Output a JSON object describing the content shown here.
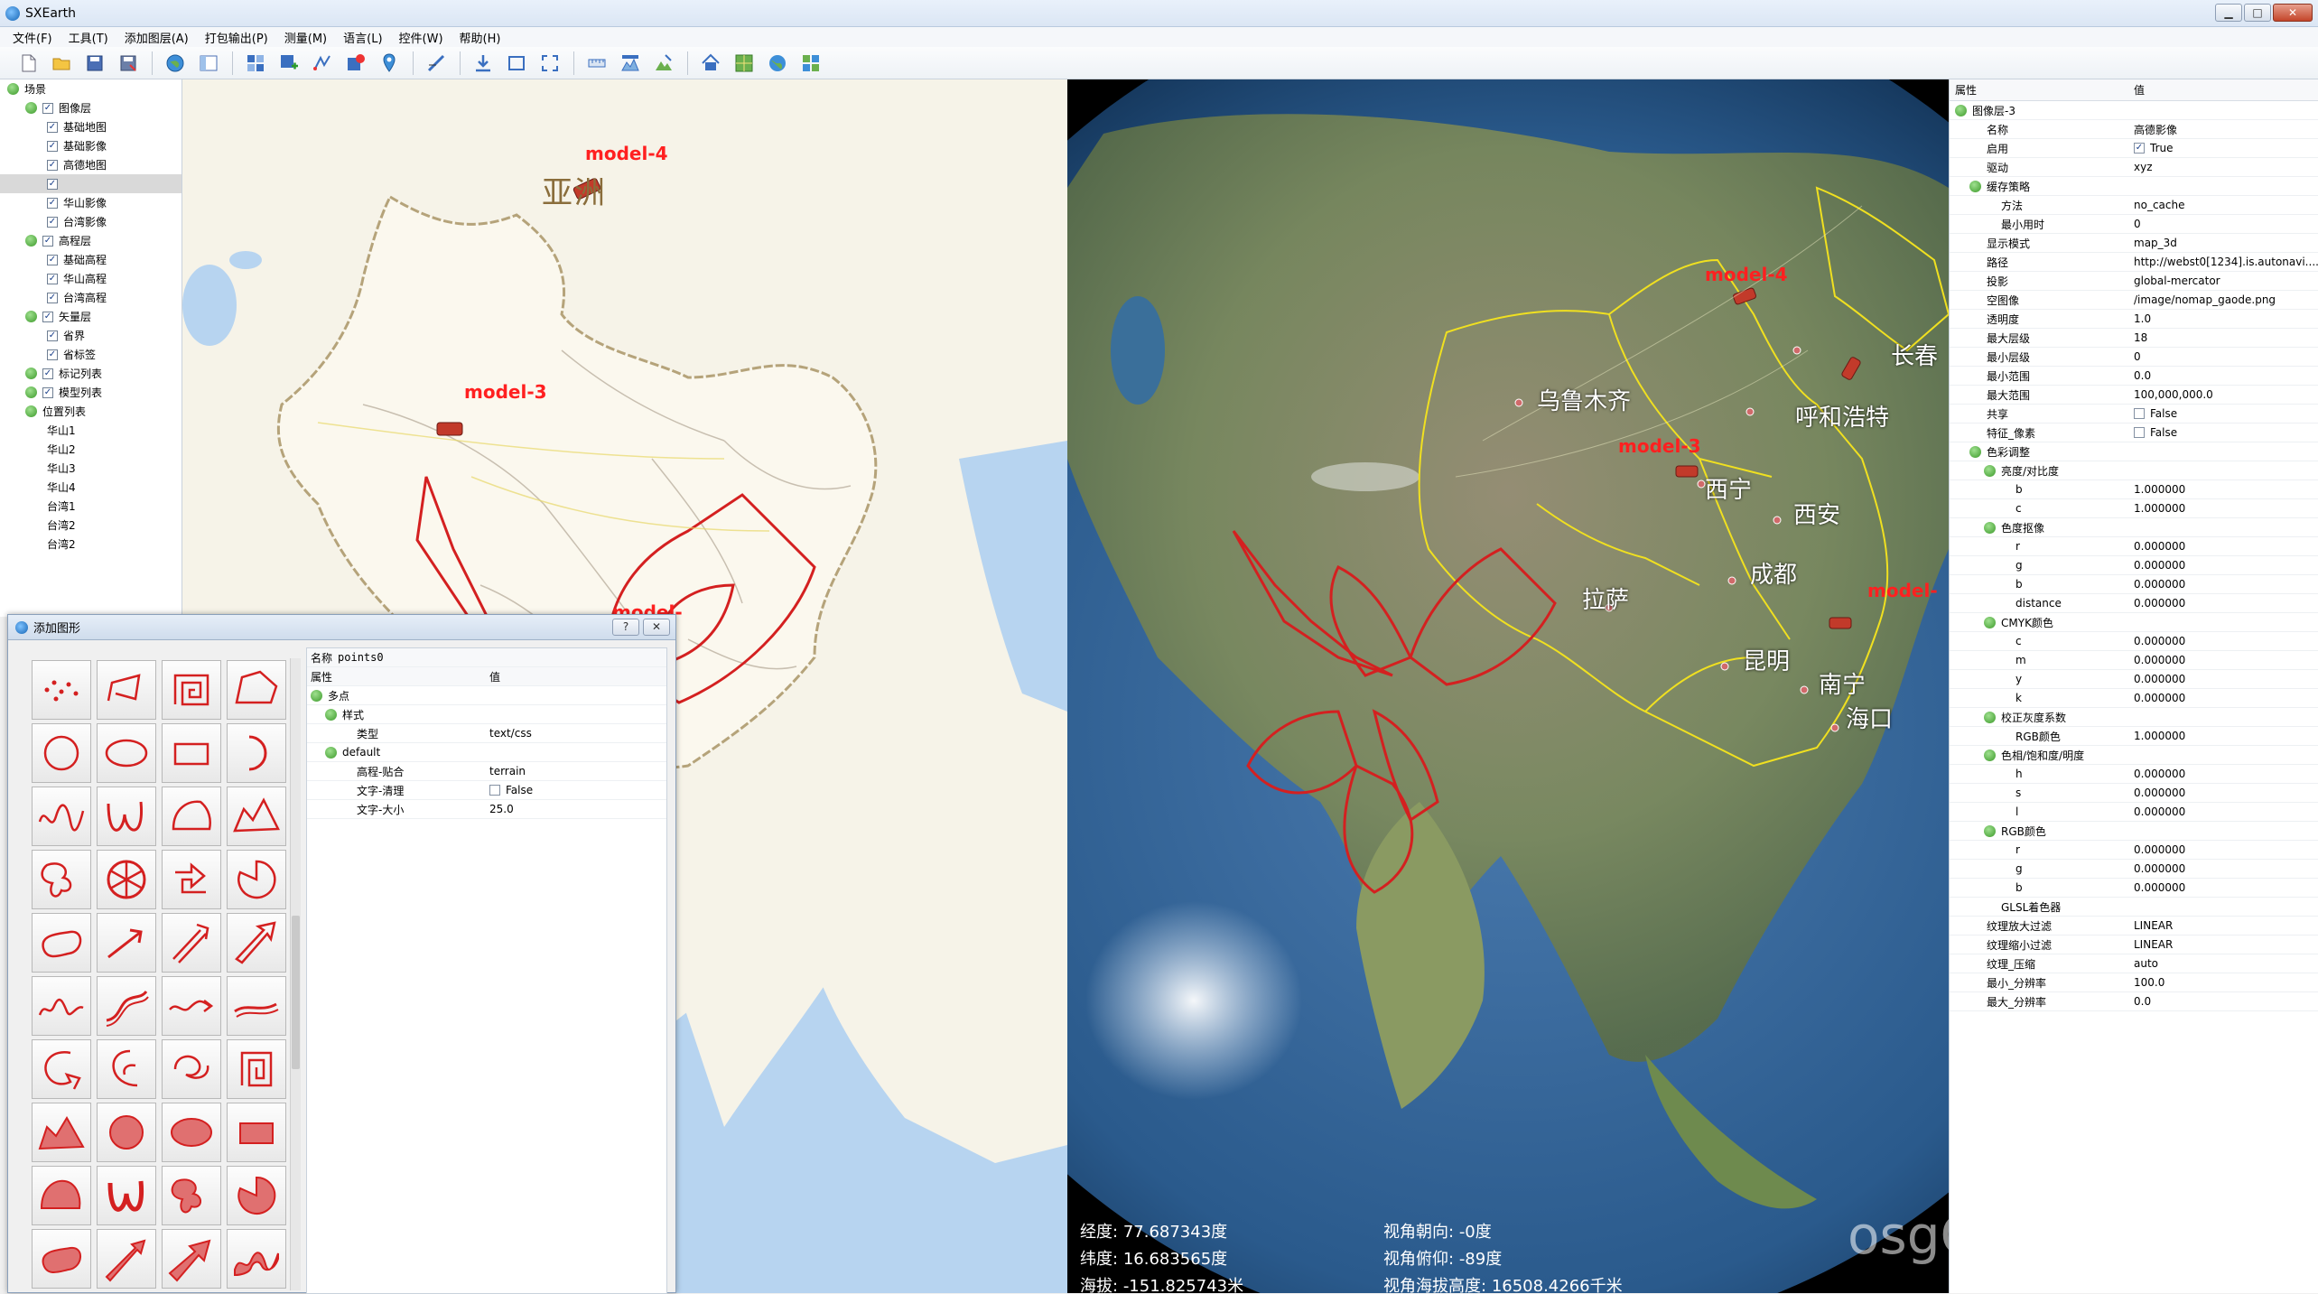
{
  "window": {
    "title": "SXEarth",
    "btn_min": "▁",
    "btn_max": "□",
    "btn_close": "✕"
  },
  "menu": [
    "文件(F)",
    "工具(T)",
    "添加图层(A)",
    "打包输出(P)",
    "测量(M)",
    "语言(L)",
    "控件(W)",
    "帮助(H)"
  ],
  "toolbar": [
    "new-file-icon",
    "open-folder-icon",
    "save-icon",
    "save-as-icon",
    "globe-icon",
    "layout-icon",
    "grid-tiles-icon",
    "add-layer-icon",
    "vector-icon",
    "pin-layer-icon",
    "placemark-icon",
    "measure-icon",
    "download-icon",
    "select-rect-icon",
    "fullscreen-icon",
    "ruler-icon",
    "profile-icon",
    "terrain-edit-icon",
    "home-icon",
    "map-icon",
    "earth-icon",
    "tile-icon"
  ],
  "scene_tree": {
    "rows": [
      {
        "level": 0,
        "exp": true,
        "chk": false,
        "label": "场景"
      },
      {
        "level": 1,
        "exp": true,
        "chk": true,
        "label": "图像层"
      },
      {
        "level": 2,
        "exp": false,
        "chk": true,
        "label": "基础地图"
      },
      {
        "level": 2,
        "exp": false,
        "chk": true,
        "label": "基础影像"
      },
      {
        "level": 2,
        "exp": false,
        "chk": true,
        "label": "高德地图"
      },
      {
        "level": 2,
        "exp": false,
        "chk": true,
        "label": "",
        "selected": true
      },
      {
        "level": 2,
        "exp": false,
        "chk": true,
        "label": "华山影像"
      },
      {
        "level": 2,
        "exp": false,
        "chk": true,
        "label": "台湾影像"
      },
      {
        "level": 1,
        "exp": true,
        "chk": true,
        "label": "高程层"
      },
      {
        "level": 2,
        "exp": false,
        "chk": true,
        "label": "基础高程"
      },
      {
        "level": 2,
        "exp": false,
        "chk": true,
        "label": "华山高程"
      },
      {
        "level": 2,
        "exp": false,
        "chk": true,
        "label": "台湾高程"
      },
      {
        "level": 1,
        "exp": true,
        "chk": true,
        "label": "矢量层"
      },
      {
        "level": 2,
        "exp": false,
        "chk": true,
        "label": "省界"
      },
      {
        "level": 2,
        "exp": false,
        "chk": true,
        "label": "省标签"
      },
      {
        "level": 1,
        "exp": true,
        "chk": true,
        "label": "标记列表"
      },
      {
        "level": 1,
        "exp": true,
        "chk": true,
        "label": "模型列表"
      },
      {
        "level": 1,
        "exp": true,
        "chk": false,
        "label": "位置列表"
      },
      {
        "level": 2,
        "exp": false,
        "chk": false,
        "label": "华山1"
      },
      {
        "level": 2,
        "exp": false,
        "chk": false,
        "label": "华山2"
      },
      {
        "level": 2,
        "exp": false,
        "chk": false,
        "label": "华山3"
      },
      {
        "level": 2,
        "exp": false,
        "chk": false,
        "label": "华山4"
      },
      {
        "level": 2,
        "exp": false,
        "chk": false,
        "label": "台湾1"
      },
      {
        "level": 2,
        "exp": false,
        "chk": false,
        "label": "台湾2"
      },
      {
        "level": 2,
        "exp": false,
        "chk": false,
        "label": "台湾2"
      }
    ]
  },
  "map2d": {
    "continent_label": "亚洲",
    "model_labels": [
      "model-4",
      "model-3",
      "model-"
    ]
  },
  "globe": {
    "cities": [
      "乌鲁木齐",
      "长春",
      "呼和浩特",
      "西宁",
      "西安",
      "成都",
      "拉萨",
      "昆明",
      "南宁",
      "海口"
    ],
    "model_labels": [
      "model-4",
      "model-3",
      "model-"
    ],
    "readout": {
      "lon_label": "经度:",
      "lon_value": "77.687343度",
      "lat_label": "纬度:",
      "lat_value": "16.683565度",
      "alt_label": "海拔:",
      "alt_value": "-151.825743米",
      "heading_label": "视角朝向:",
      "heading_value": "-0度",
      "pitch_label": "视角俯仰:",
      "pitch_value": "-89度",
      "eye_label": "视角海拔高度:",
      "eye_value": "16508.4266千米"
    },
    "watermark": "osgChina.org"
  },
  "props": {
    "header": [
      "属性",
      "值"
    ],
    "rows": [
      {
        "level": 0,
        "exp": true,
        "name": "图像层-3",
        "value": ""
      },
      {
        "level": 1,
        "name": "名称",
        "value": "高德影像"
      },
      {
        "level": 1,
        "name": "启用",
        "value": "True",
        "check": true
      },
      {
        "level": 1,
        "name": "驱动",
        "value": "xyz"
      },
      {
        "level": 1,
        "exp": true,
        "name": "缓存策略",
        "value": ""
      },
      {
        "level": 2,
        "name": "方法",
        "value": "no_cache"
      },
      {
        "level": 2,
        "name": "最小用时",
        "value": "0"
      },
      {
        "level": 1,
        "name": "显示模式",
        "value": "map_3d"
      },
      {
        "level": 1,
        "name": "路径",
        "value": "http://webst0[1234].is.autonavi...."
      },
      {
        "level": 1,
        "name": "投影",
        "value": "global-mercator"
      },
      {
        "level": 1,
        "name": "空图像",
        "value": "/image/nomap_gaode.png"
      },
      {
        "level": 1,
        "name": "透明度",
        "value": "1.0"
      },
      {
        "level": 1,
        "name": "最大层级",
        "value": "18"
      },
      {
        "level": 1,
        "name": "最小层级",
        "value": "0"
      },
      {
        "level": 1,
        "name": "最小范围",
        "value": "0.0"
      },
      {
        "level": 1,
        "name": "最大范围",
        "value": "100,000,000.0"
      },
      {
        "level": 1,
        "name": "共享",
        "value": "False",
        "check": false
      },
      {
        "level": 1,
        "name": "特征_像素",
        "value": "False",
        "check": false
      },
      {
        "level": 1,
        "exp": true,
        "name": "色彩调整",
        "value": ""
      },
      {
        "level": 2,
        "exp": true,
        "name": "亮度/对比度",
        "value": ""
      },
      {
        "level": 3,
        "name": "b",
        "value": "1.000000"
      },
      {
        "level": 3,
        "name": "c",
        "value": "1.000000"
      },
      {
        "level": 2,
        "exp": true,
        "name": "色度抠像",
        "value": ""
      },
      {
        "level": 3,
        "name": "r",
        "value": "0.000000"
      },
      {
        "level": 3,
        "name": "g",
        "value": "0.000000"
      },
      {
        "level": 3,
        "name": "b",
        "value": "0.000000"
      },
      {
        "level": 3,
        "name": "distance",
        "value": "0.000000"
      },
      {
        "level": 2,
        "exp": true,
        "name": "CMYK颜色",
        "value": ""
      },
      {
        "level": 3,
        "name": "c",
        "value": "0.000000"
      },
      {
        "level": 3,
        "name": "m",
        "value": "0.000000"
      },
      {
        "level": 3,
        "name": "y",
        "value": "0.000000"
      },
      {
        "level": 3,
        "name": "k",
        "value": "0.000000"
      },
      {
        "level": 2,
        "exp": true,
        "name": "校正灰度系数",
        "value": ""
      },
      {
        "level": 3,
        "name": "RGB颜色",
        "value": "1.000000"
      },
      {
        "level": 2,
        "exp": true,
        "name": "色相/饱和度/明度",
        "value": ""
      },
      {
        "level": 3,
        "name": "h",
        "value": "0.000000"
      },
      {
        "level": 3,
        "name": "s",
        "value": "0.000000"
      },
      {
        "level": 3,
        "name": "l",
        "value": "0.000000"
      },
      {
        "level": 2,
        "exp": true,
        "name": "RGB颜色",
        "value": ""
      },
      {
        "level": 3,
        "name": "r",
        "value": "0.000000"
      },
      {
        "level": 3,
        "name": "g",
        "value": "0.000000"
      },
      {
        "level": 3,
        "name": "b",
        "value": "0.000000"
      },
      {
        "level": 2,
        "name": "GLSL着色器",
        "value": ""
      },
      {
        "level": 1,
        "name": "纹理放大过滤",
        "value": "LINEAR"
      },
      {
        "level": 1,
        "name": "纹理缩小过滤",
        "value": "LINEAR"
      },
      {
        "level": 1,
        "name": "纹理_压缩",
        "value": "auto"
      },
      {
        "level": 1,
        "name": "最小_分辨率",
        "value": "100.0"
      },
      {
        "level": 1,
        "name": "最大_分辨率",
        "value": "0.0"
      }
    ]
  },
  "dialog": {
    "title": "添加图形",
    "help_btn": "?",
    "close_btn": "✕",
    "name_label": "名称",
    "name_value": "points0",
    "header": [
      "属性",
      "值"
    ],
    "rows": [
      {
        "level": 0,
        "exp": true,
        "name": "多点",
        "value": ""
      },
      {
        "level": 1,
        "exp": true,
        "name": "样式",
        "value": ""
      },
      {
        "level": 2,
        "name": "类型",
        "value": "text/css"
      },
      {
        "level": 1,
        "exp": true,
        "name": "default",
        "value": ""
      },
      {
        "level": 2,
        "name": "高程-贴合",
        "value": "terrain"
      },
      {
        "level": 2,
        "name": "文字-清理",
        "value": "False",
        "check": false
      },
      {
        "level": 2,
        "name": "文字-大小",
        "value": "25.0"
      }
    ],
    "shapes": [
      "points-shape",
      "polyline-shape",
      "spiral-line-shape",
      "polygon-outline-shape",
      "circle-outline-shape",
      "ellipse-outline-shape",
      "rectangle-outline-shape",
      "arc-shape",
      "wave-line-shape",
      "curve-w-shape",
      "sector-outline-shape",
      "mountain-outline-shape",
      "blob-outline-shape",
      "wheel-shape",
      "route-shape",
      "pie-outline-shape",
      "oval-blob-shape",
      "arrow-line-shape",
      "double-line-arrow-shape",
      "double-arrow-outline-shape",
      "zigzag-curve-shape",
      "s-curve-shape",
      "wave-arrow-shape",
      "curve-arrow-shape",
      "swirl-arrow-shape",
      "multi-arrow-shape",
      "hook-arrow-shape",
      "square-spiral-shape",
      "mountain-fill-shape",
      "circle-fill-shape",
      "ellipse-fill-shape",
      "rectangle-fill-shape",
      "dome-fill-shape",
      "w-fill-shape",
      "blob-fill-shape",
      "pie-fill-shape",
      "oval-fill-shape",
      "arrow-fill-shape",
      "thick-arrow-fill-shape",
      "wave-fill-shape"
    ]
  },
  "colors": {
    "shape_red": "#d42020",
    "model_red": "#ff2020",
    "prov_yellow": "#f0e020"
  }
}
